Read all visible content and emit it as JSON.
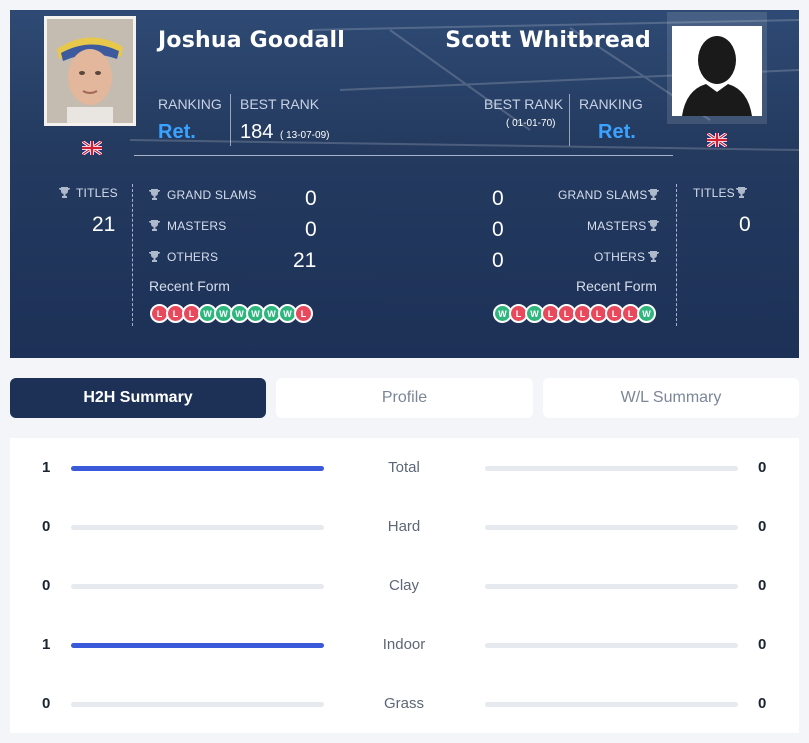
{
  "player1": {
    "name": "Joshua Goodall",
    "ranking_label": "RANKING",
    "ranking_value": "Ret.",
    "best_rank_label": "BEST RANK",
    "best_rank_value": "184",
    "best_rank_date": "( 13-07-09)",
    "flag": "uk-flag-icon",
    "titles_label": "TITLES",
    "titles_value": "21",
    "grand_slams_label": "GRAND SLAMS",
    "grand_slams_value": "0",
    "masters_label": "MASTERS",
    "masters_value": "0",
    "others_label": "OTHERS",
    "others_value": "21",
    "recent_form_label": "Recent Form",
    "recent_form": [
      "L",
      "L",
      "L",
      "W",
      "W",
      "W",
      "W",
      "W",
      "W",
      "L"
    ]
  },
  "player2": {
    "name": "Scott Whitbread",
    "ranking_label": "RANKING",
    "ranking_value": "Ret.",
    "best_rank_label": "BEST RANK",
    "best_rank_date": "( 01-01-70)",
    "flag": "uk-flag-icon",
    "titles_label": "TITLES",
    "titles_value": "0",
    "grand_slams_label": "GRAND SLAMS",
    "grand_slams_value": "0",
    "masters_label": "MASTERS",
    "masters_value": "0",
    "others_label": "OTHERS",
    "others_value": "0",
    "recent_form_label": "Recent Form",
    "recent_form": [
      "W",
      "L",
      "W",
      "L",
      "L",
      "L",
      "L",
      "L",
      "L",
      "W"
    ]
  },
  "tabs": [
    {
      "label": "H2H Summary",
      "active": true
    },
    {
      "label": "Profile",
      "active": false
    },
    {
      "label": "W/L Summary",
      "active": false
    }
  ],
  "h2h": [
    {
      "label": "Total",
      "p1": "1",
      "p2": "0",
      "p1_share": 1,
      "p2_share": 0
    },
    {
      "label": "Hard",
      "p1": "0",
      "p2": "0",
      "p1_share": 0,
      "p2_share": 0
    },
    {
      "label": "Clay",
      "p1": "0",
      "p2": "0",
      "p1_share": 0,
      "p2_share": 0
    },
    {
      "label": "Indoor",
      "p1": "1",
      "p2": "0",
      "p1_share": 1,
      "p2_share": 0
    },
    {
      "label": "Grass",
      "p1": "0",
      "p2": "0",
      "p1_share": 0,
      "p2_share": 0
    }
  ],
  "colors": {
    "accent": "#3aa3ff",
    "bar_fill": "#3a5ad9",
    "win": "#2eb67d",
    "loss": "#e8495c",
    "header_bg": "#1d3157"
  }
}
